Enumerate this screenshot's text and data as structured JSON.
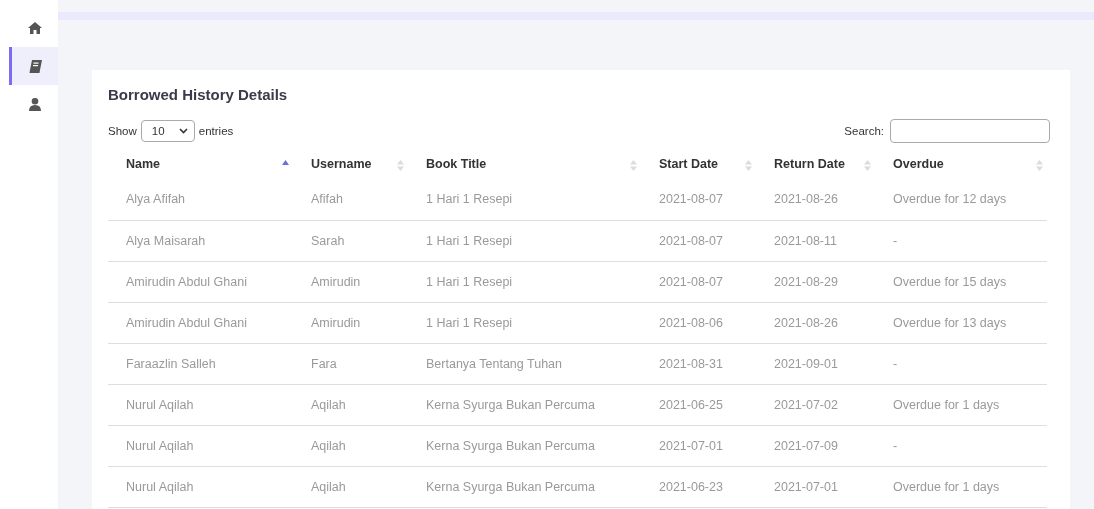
{
  "sidebar": {
    "items": [
      {
        "selected": false
      },
      {
        "selected": true
      },
      {
        "selected": false
      }
    ]
  },
  "card": {
    "title": "Borrowed History Details",
    "length": {
      "before": "Show",
      "value": "10",
      "after": "entries"
    },
    "search": {
      "label": "Search:"
    },
    "table": {
      "columns": [
        {
          "label": "Name",
          "sorted": true
        },
        {
          "label": "Username",
          "sorted": false
        },
        {
          "label": "Book Title",
          "sorted": false
        },
        {
          "label": "Start Date",
          "sorted": false
        },
        {
          "label": "Return Date",
          "sorted": false
        },
        {
          "label": "Overdue",
          "sorted": false
        }
      ],
      "rows": [
        [
          "Alya Afifah",
          "Afifah",
          "1 Hari 1 Resepi",
          "2021-08-07",
          "2021-08-26",
          "Overdue for 12 days"
        ],
        [
          "Alya Maisarah",
          "Sarah",
          "1 Hari 1 Resepi",
          "2021-08-07",
          "2021-08-11",
          "-"
        ],
        [
          "Amirudin Abdul Ghani",
          "Amirudin",
          "1 Hari 1 Resepi",
          "2021-08-07",
          "2021-08-29",
          "Overdue for 15 days"
        ],
        [
          "Amirudin Abdul Ghani",
          "Amirudin",
          "1 Hari 1 Resepi",
          "2021-08-06",
          "2021-08-26",
          "Overdue for 13 days"
        ],
        [
          "Faraazlin Salleh",
          "Fara",
          "Bertanya Tentang Tuhan",
          "2021-08-31",
          "2021-09-01",
          "-"
        ],
        [
          "Nurul Aqilah",
          "Aqilah",
          "Kerna Syurga Bukan Percuma",
          "2021-06-25",
          "2021-07-02",
          "Overdue for 1 days"
        ],
        [
          "Nurul Aqilah",
          "Aqilah",
          "Kerna Syurga Bukan Percuma",
          "2021-07-01",
          "2021-07-09",
          "-"
        ],
        [
          "Nurul Aqilah",
          "Aqilah",
          "Kerna Syurga Bukan Percuma",
          "2021-06-23",
          "2021-07-01",
          "Overdue for 1 days"
        ]
      ]
    }
  }
}
